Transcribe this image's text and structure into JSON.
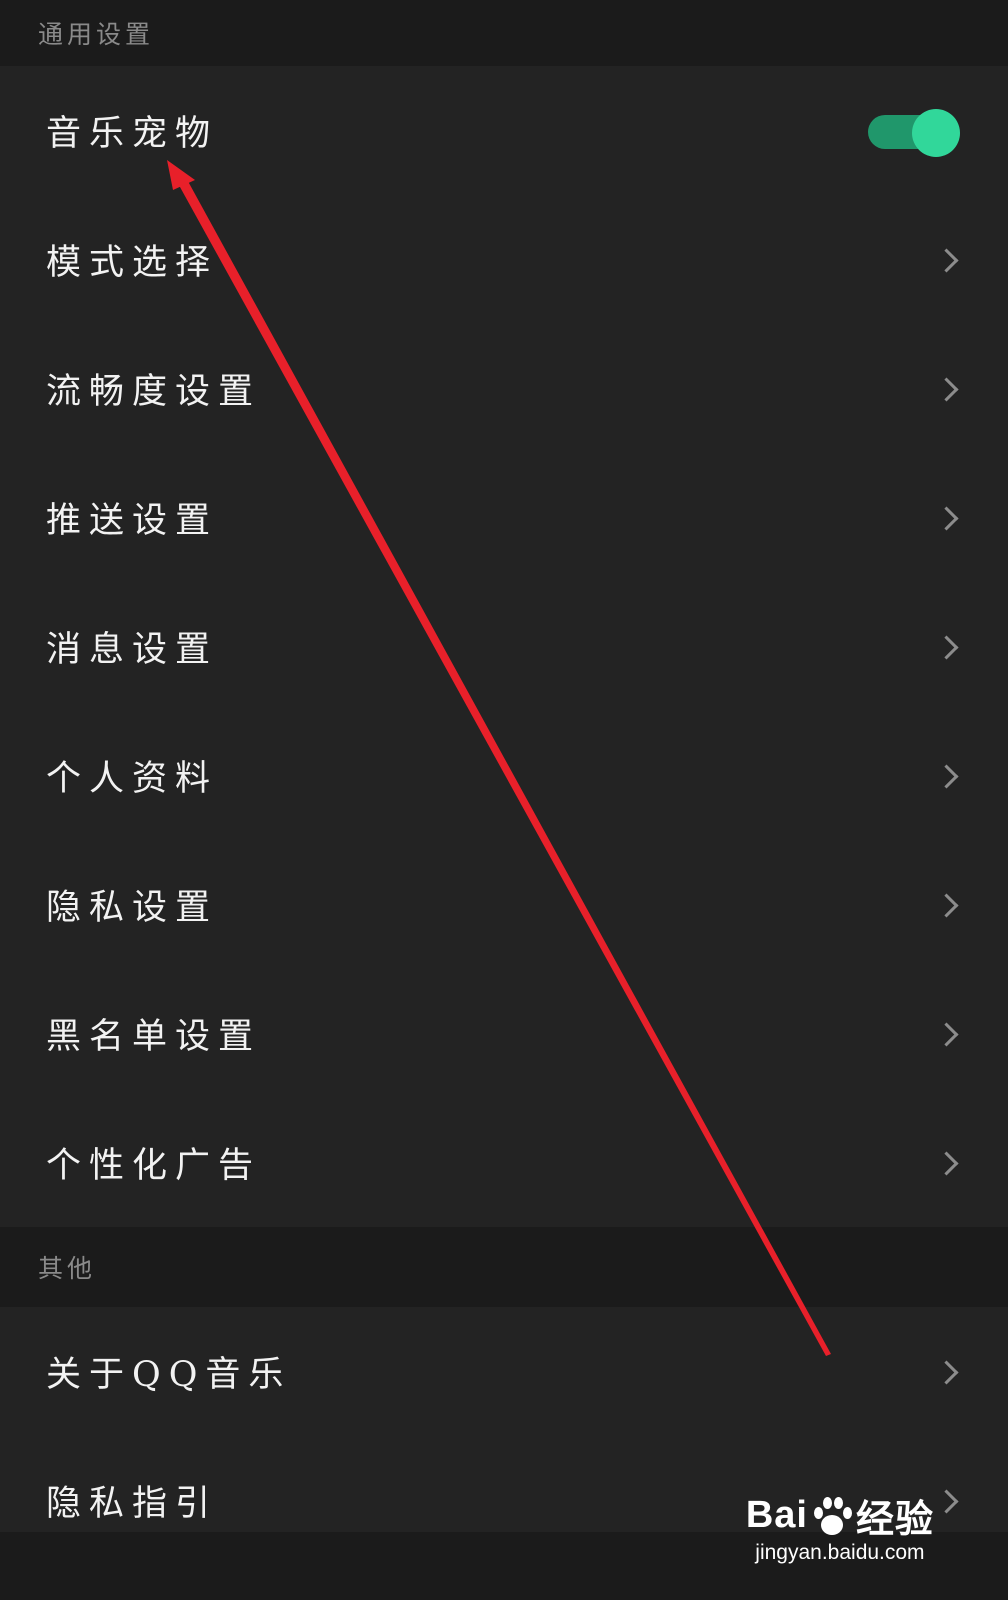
{
  "sections": {
    "general_title": "通用设置",
    "other_title": "其他"
  },
  "general_items": [
    {
      "label": "音乐宠物",
      "control": "toggle",
      "toggle_on": true
    },
    {
      "label": "模式选择",
      "control": "chevron-right-icon"
    },
    {
      "label": "流畅度设置",
      "control": "chevron-right-icon"
    },
    {
      "label": "推送设置",
      "control": "chevron-right-icon"
    },
    {
      "label": "消息设置",
      "control": "chevron-right-icon"
    },
    {
      "label": "个人资料",
      "control": "chevron-right-icon"
    },
    {
      "label": "隐私设置",
      "control": "chevron-right-icon"
    },
    {
      "label": "黑名单设置",
      "control": "chevron-right-icon"
    },
    {
      "label": "个性化广告",
      "control": "chevron-right-icon"
    }
  ],
  "other_items": [
    {
      "label": "关于QQ音乐",
      "control": "chevron-right-icon"
    },
    {
      "label": "隐私指引",
      "control": "chevron-right-icon"
    }
  ],
  "colors": {
    "background": "#1c1c1c",
    "row_background": "#232323",
    "toggle_track": "#20976b",
    "toggle_knob": "#31d79a",
    "annotation_arrow": "#e8202a"
  },
  "watermark": {
    "logo_text": "Bai",
    "logo_text_2": "经验",
    "url": "jingyan.baidu.com"
  }
}
